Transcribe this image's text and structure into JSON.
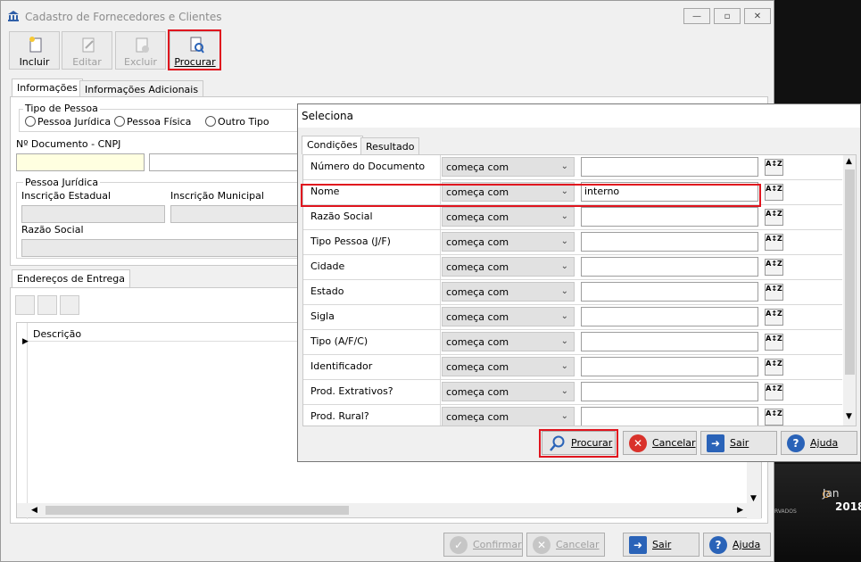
{
  "window": {
    "title": "Cadastro de Fornecedores e Clientes",
    "minimize": "—",
    "maximize": "▫",
    "close": "✕"
  },
  "toolbar": {
    "incluir": "Incluir",
    "editar": "Editar",
    "excluir": "Excluir",
    "procurar": "Procurar"
  },
  "tabs": {
    "informacoes": "Informações",
    "informacoes_adicionais": "Informações Adicionais"
  },
  "tipo_pessoa": {
    "title": "Tipo de Pessoa",
    "juridica": "Pessoa Jurídica",
    "fisica": "Pessoa Física",
    "outro": "Outro Tipo"
  },
  "documento": {
    "label": "Nº Documento - CNPJ"
  },
  "pessoa_juridica": {
    "title": "Pessoa Jurídica",
    "inscricao_estadual": "Inscrição Estadual",
    "inscricao_municipal": "Inscrição Municipal",
    "razao_social": "Razão Social"
  },
  "enderecos": {
    "tab": "Endereços de Entrega",
    "column_descricao": "Descrição"
  },
  "bottom_buttons": {
    "confirmar": "Confirmar",
    "cancelar": "Cancelar",
    "sair": "Sair",
    "ajuda": "Ajuda"
  },
  "dialog": {
    "title": "Seleciona",
    "tab_condicoes": "Condições",
    "tab_resultado": "Resultado",
    "rows": [
      {
        "field": "Número do Documento",
        "operator": "começa com",
        "value": ""
      },
      {
        "field": "Nome",
        "operator": "começa com",
        "value": "interno"
      },
      {
        "field": "Razão Social",
        "operator": "começa com",
        "value": ""
      },
      {
        "field": "Tipo Pessoa (J/F)",
        "operator": "começa com",
        "value": ""
      },
      {
        "field": "Cidade",
        "operator": "começa com",
        "value": ""
      },
      {
        "field": "Estado",
        "operator": "começa com",
        "value": ""
      },
      {
        "field": "Sigla",
        "operator": "começa com",
        "value": ""
      },
      {
        "field": "Tipo (A/F/C)",
        "operator": "começa com",
        "value": ""
      },
      {
        "field": "Identificador",
        "operator": "começa com",
        "value": ""
      },
      {
        "field": "Prod. Extrativos?",
        "operator": "começa com",
        "value": ""
      },
      {
        "field": "Prod. Rural?",
        "operator": "começa com",
        "value": ""
      }
    ],
    "sort_icon_text": "A↕Z",
    "buttons": {
      "procurar": "Procurar",
      "cancelar": "Cancelar",
      "sair": "Sair",
      "ajuda": "Ajuda"
    }
  },
  "background": {
    "month": "Jan",
    "year": "2018",
    "caption": "RVADOS"
  },
  "colors": {
    "highlight": "#e0141e",
    "cancel_red": "#d9322b",
    "help_blue": "#2a63b8",
    "confirm_gray": "#b8b8b8"
  }
}
